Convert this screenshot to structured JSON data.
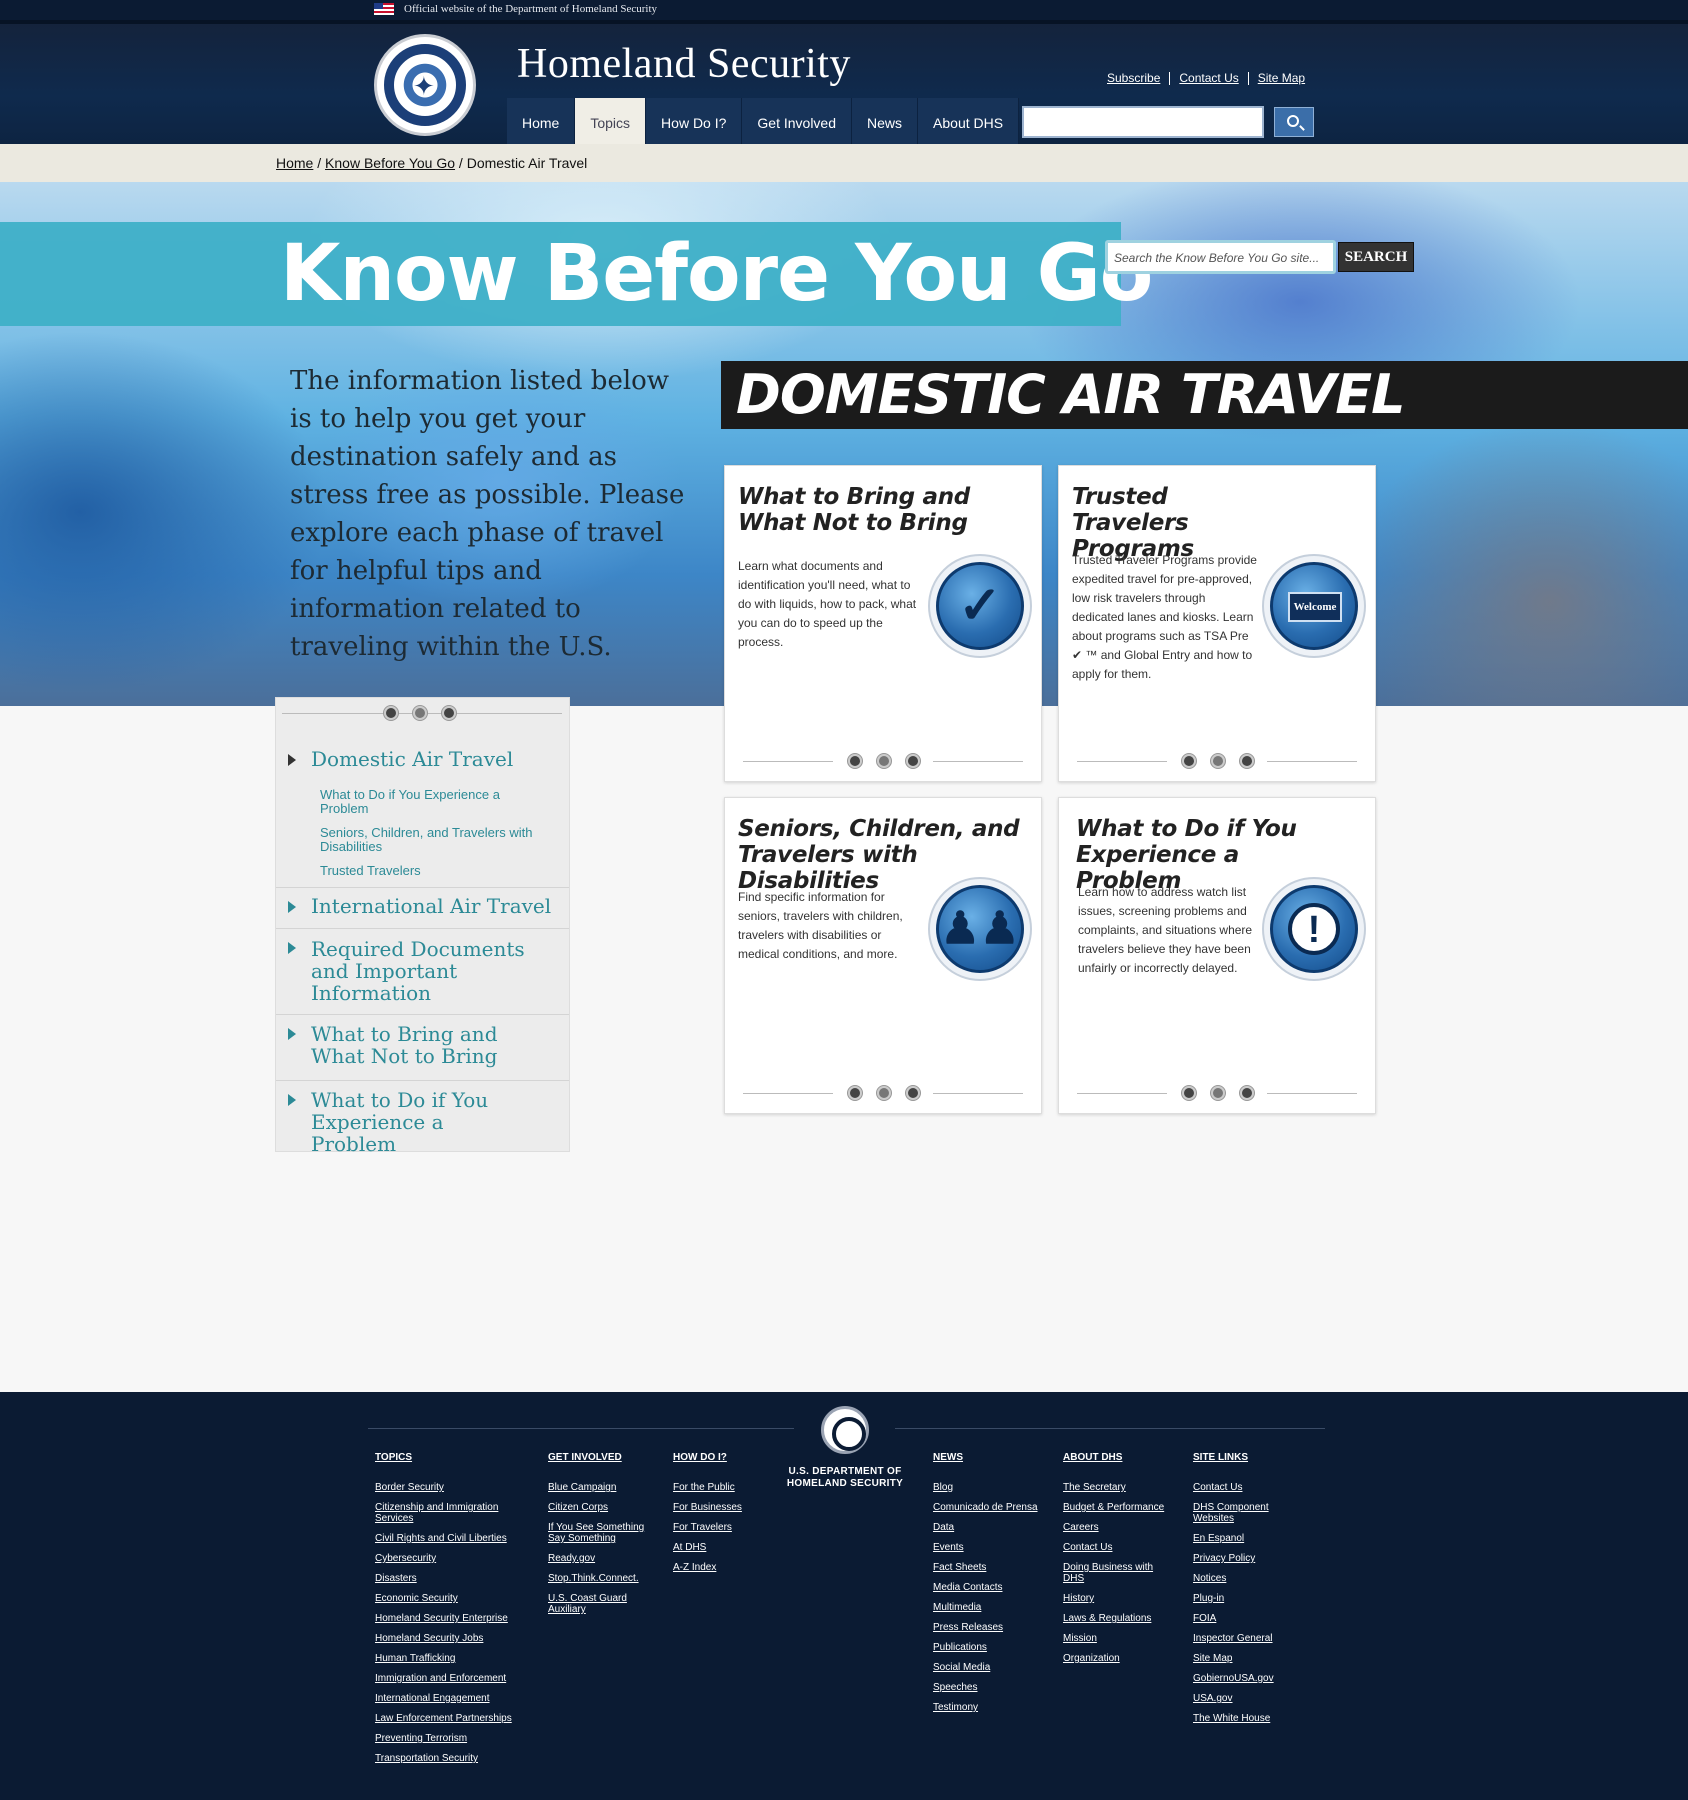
{
  "official_bar": {
    "text": "Official website of the Department of Homeland Security"
  },
  "header": {
    "title": "Homeland Security",
    "utility_links": [
      "Subscribe",
      "Contact Us",
      "Site Map"
    ],
    "nav": [
      "Home",
      "Topics",
      "How Do I?",
      "Get Involved",
      "News",
      "About DHS"
    ],
    "active_nav": "Topics",
    "search_value": ""
  },
  "breadcrumb": {
    "items": [
      "Home",
      "Know Before You Go"
    ],
    "current": "Domestic Air Travel",
    "separator": " / "
  },
  "hero": {
    "banner_title": "Know Before You Go",
    "search_placeholder": "Search the Know Before You Go site...",
    "search_button": "SEARCH",
    "intro": "The information listed below is to help you get your destination safely and as stress free as possible. Please explore each phase of travel for helpful tips and information related to traveling within the U.S.",
    "section_title": "DOMESTIC AIR TRAVEL"
  },
  "sidebar": {
    "items": [
      {
        "label": "Domestic Air Travel",
        "subitems": [
          "What to Do if You Experience a Problem",
          "Seniors, Children, and Travelers with Disabilities",
          "Trusted Travelers"
        ]
      },
      {
        "label": "International Air Travel"
      },
      {
        "label": "Required Documents and Important Information"
      },
      {
        "label": "What to Bring and What Not to Bring"
      },
      {
        "label": "What to Do if You Experience a Problem"
      }
    ]
  },
  "cards": [
    {
      "title": "What to Bring and What Not to Bring",
      "body": "Learn what documents and identification you'll need, what to do with liquids, how to pack, what you can do to speed up the process.",
      "icon": "luggage-check-icon"
    },
    {
      "title": "Trusted Travelers Programs",
      "body": "Trusted Traveler Programs provide expedited travel for pre-approved, low risk travelers through dedicated lanes and kiosks. Learn about programs such as TSA Pre ✔ ™ and Global Entry and how to apply for them.",
      "icon": "welcome-sign-icon",
      "icon_text": "Welcome"
    },
    {
      "title": "Seniors, Children, and Travelers with Disabilities",
      "body": "Find specific information for seniors, travelers with children, travelers with disabilities or medical conditions, and more.",
      "icon": "family-icon"
    },
    {
      "title": "What to Do if You Experience a Problem",
      "body": "Learn how to address watch list issues, screening problems and complaints, and situations where travelers believe they have been unfairly or incorrectly delayed.",
      "icon": "exclamation-icon"
    }
  ],
  "footer": {
    "org": "U.S. DEPARTMENT OF HOMELAND SECURITY",
    "columns": [
      {
        "heading": "TOPICS",
        "links": [
          "Border Security",
          "Citizenship and Immigration Services",
          "Civil Rights and Civil Liberties",
          "Cybersecurity",
          "Disasters",
          "Economic Security",
          "Homeland Security Enterprise",
          "Homeland Security Jobs",
          "Human Trafficking",
          "Immigration and Enforcement",
          "International Engagement",
          "Law Enforcement Partnerships",
          "Preventing Terrorism",
          "Transportation Security"
        ]
      },
      {
        "heading": "GET INVOLVED",
        "links": [
          "Blue Campaign",
          "Citizen Corps",
          "If You See Something Say Something",
          "Ready.gov",
          "Stop.Think.Connect.",
          "U.S. Coast Guard Auxiliary"
        ]
      },
      {
        "heading": "HOW DO I?",
        "links": [
          "For the Public",
          "For Businesses",
          "For Travelers",
          "At DHS",
          "A-Z Index"
        ]
      },
      {
        "heading": "NEWS",
        "links": [
          "Blog",
          "Comunicado de Prensa",
          "Data",
          "Events",
          "Fact Sheets",
          "Media Contacts",
          "Multimedia",
          "Press Releases",
          "Publications",
          "Social Media",
          "Speeches",
          "Testimony"
        ]
      },
      {
        "heading": "ABOUT DHS",
        "links": [
          "The Secretary",
          "Budget & Performance",
          "Careers",
          "Contact Us",
          "Doing Business with DHS",
          "History",
          "Laws & Regulations",
          "Mission",
          "Organization"
        ]
      },
      {
        "heading": "SITE LINKS",
        "links": [
          "Contact Us",
          "DHS Component Websites",
          "En Espanol",
          "Privacy Policy",
          "Notices",
          "Plug-in",
          "FOIA",
          "Inspector General",
          "Site Map",
          "GobiernoUSA.gov",
          "USA.gov",
          "The White House"
        ]
      }
    ]
  }
}
